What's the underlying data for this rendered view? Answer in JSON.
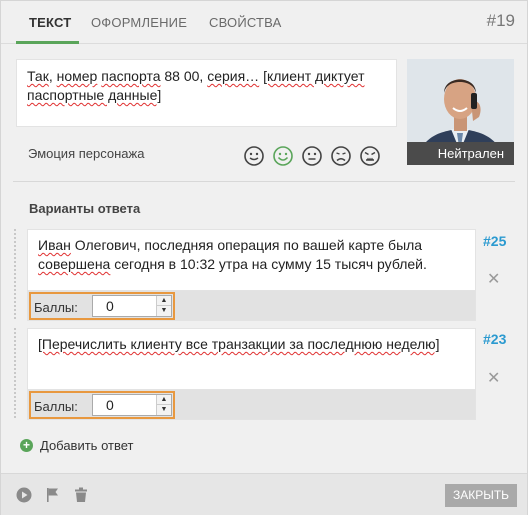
{
  "tabs": [
    {
      "label": "ТЕКСТ",
      "active": true
    },
    {
      "label": "ОФОРМЛЕНИЕ",
      "active": false
    },
    {
      "label": "СВОЙСТВА",
      "active": false
    }
  ],
  "item_number": "#19",
  "message": {
    "part1": "Так",
    "part2": ", ",
    "part3": "номер",
    "part4": " ",
    "part5": "паспорта",
    "part6": " 88 00, ",
    "part7": "серия…",
    "part8": " ",
    "part9": "[клиент диктует паспортные данные]"
  },
  "character": {
    "emotion_name": "Нейтрален"
  },
  "emotion_label": "Эмоция персонажа",
  "emotions": [
    "neutral-face-icon",
    "smile-face-icon",
    "flat-face-icon",
    "sad-face-icon",
    "angry-face-icon"
  ],
  "answers_title": "Варианты ответа",
  "answers": [
    {
      "line1_a": "Иван",
      "line1_b": " Олегович, последняя операция по вашей карте была",
      "line2_a": "совершена",
      "line2_b": " сегодня в 10:32 утра на сумму 15 тысяч рублей.",
      "score_label": "Баллы:",
      "score_value": "0",
      "ref": "#25"
    },
    {
      "line1_a": "[Перечислить клиенту все транзакции за последнюю неделю]",
      "score_label": "Баллы:",
      "score_value": "0",
      "ref": "#23"
    }
  ],
  "add_answer_label": "Добавить ответ",
  "footer": {
    "close_label": "ЗАКРЫТЬ"
  },
  "colors": {
    "accent_green": "#5aa55a",
    "ref_blue": "#2b9ad0",
    "score_border": "#e8983f"
  }
}
